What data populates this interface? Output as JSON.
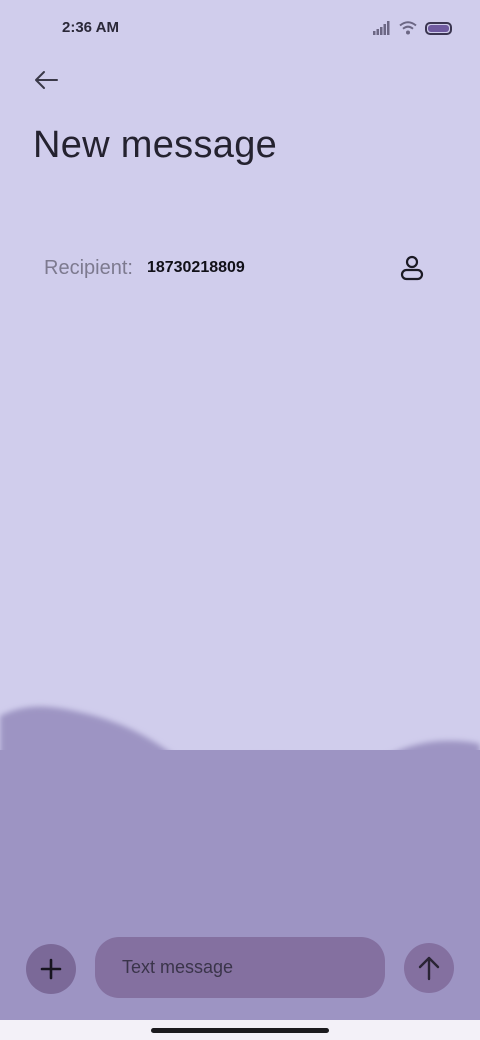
{
  "status_bar": {
    "time": "2:36 AM",
    "icons": [
      "signal-icon",
      "wifi-icon",
      "battery-icon"
    ]
  },
  "header": {
    "back_icon": "arrow-left-icon",
    "title": "New message"
  },
  "recipient": {
    "label": "Recipient:",
    "value": "18730218809",
    "contact_icon": "person-icon"
  },
  "compose": {
    "attach_icon": "plus-icon",
    "placeholder": "Text message",
    "send_icon": "arrow-up-icon"
  },
  "colors": {
    "background": "#d0cdec",
    "wave": "#9d94c3",
    "button": "#7b6998",
    "input": "#8470a0"
  }
}
